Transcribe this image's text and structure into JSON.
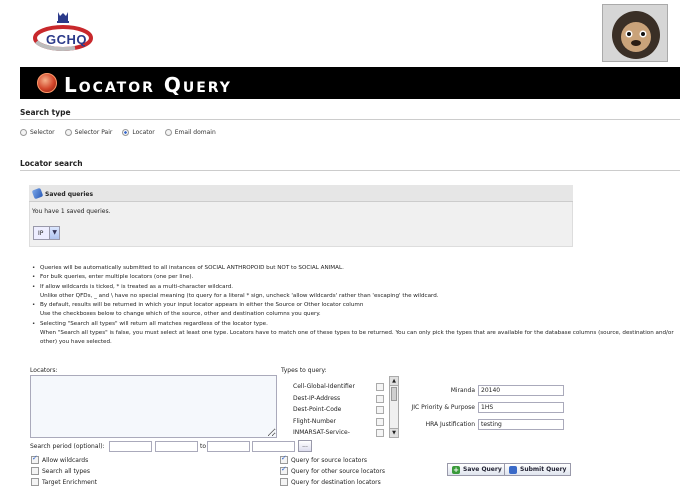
{
  "header": {
    "logo_text": "GCHQ",
    "title": "Locator Query"
  },
  "search_type": {
    "heading": "Search type",
    "options": [
      "Selector",
      "Selector Pair",
      "Locator",
      "Email domain"
    ],
    "selected": "Locator"
  },
  "locator_search": {
    "heading": "Locator search",
    "saved_queries": {
      "title": "Saved queries",
      "count_text": "You have 1 saved queries.",
      "selected": "IP"
    }
  },
  "notes": [
    "Queries will be automatically submitted to all instances of SOCIAL ANTHROPOID but NOT to SOCIAL ANIMAL.",
    "For bulk queries, enter multiple locators (one per line).",
    "If allow wildcards is ticked, * is treated as a multi-character wildcard.",
    "Unlike other QFDs, _ and \\ have no special meaning (to query for a literal * sign, uncheck 'allow wildcards' rather than 'escaping' the wildcard.",
    "By default, results will be returned in which your input locator appears in either the Source or Other locator column",
    "Use the checkboxes below to change which of the source, other and destination columns you query.",
    "Selecting \"Search all types\" will return all matches regardless of the locator type.",
    "When \"Search all types\" is false, you must select at least one type. Locators have to match one of these types to be returned. You can only pick the types that are available for the database columns (source, destination and/or other) you have selected."
  ],
  "form": {
    "locators_label": "Locators:",
    "types_label": "Types to query:",
    "types": [
      "Cell-Global-Identifier",
      "Dest-IP-Address",
      "Dest-Point-Code",
      "Flight-Number",
      "INMARSAT-Service-"
    ],
    "miranda_label": "Miranda",
    "miranda_value": "20140",
    "jic_label": "JIC Priority & Purpose",
    "jic_value": "1HS",
    "hra_label": "HRA Justification",
    "hra_value": "testing",
    "period_label": "Search period (optional):",
    "period_to": "to",
    "period_button": "...",
    "allow_wildcards": "Allow wildcards",
    "search_all_types": "Search all types",
    "target_enrichment": "Target Enrichment",
    "q_source": "Query for source locators",
    "q_other": "Query for other source locators",
    "q_dest": "Query for destination locators",
    "save_btn": "Save Query",
    "submit_btn": "Submit Query"
  }
}
